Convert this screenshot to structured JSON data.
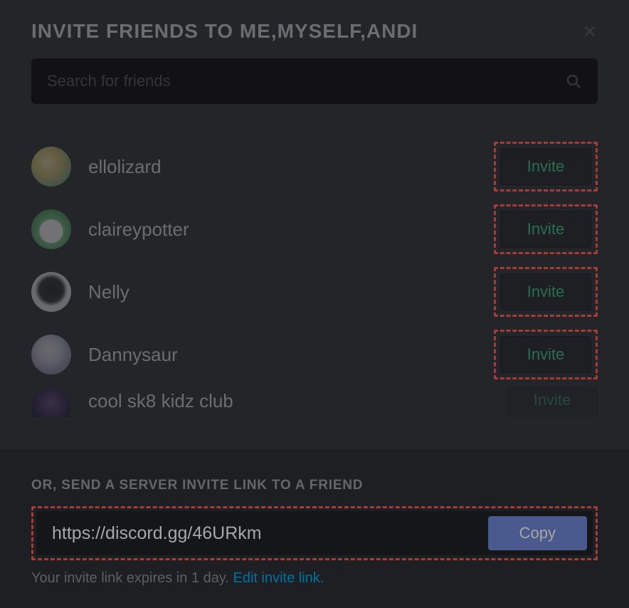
{
  "header": {
    "title": "INVITE FRIENDS TO ME,MYSELF,ANDI"
  },
  "search": {
    "placeholder": "Search for friends",
    "value": ""
  },
  "friends": [
    {
      "name": "ellolizard",
      "invite_label": "Invite"
    },
    {
      "name": "claireypotter",
      "invite_label": "Invite"
    },
    {
      "name": "Nelly",
      "invite_label": "Invite"
    },
    {
      "name": "Dannysaur",
      "invite_label": "Invite"
    },
    {
      "name": "cool sk8 kidz club",
      "invite_label": "Invite"
    }
  ],
  "footer": {
    "subtitle": "OR, SEND A SERVER INVITE LINK TO A FRIEND",
    "link": "https://discord.gg/46URkm",
    "copy_label": "Copy",
    "expiry_prefix": "Your invite link expires in 1 day. ",
    "edit_label": "Edit invite link."
  }
}
